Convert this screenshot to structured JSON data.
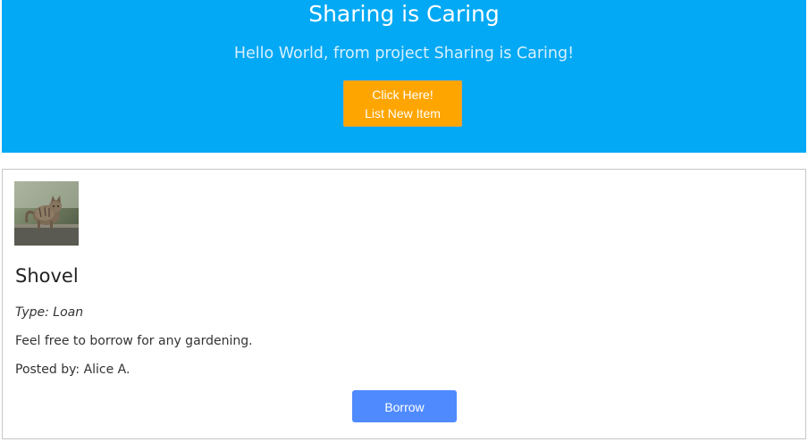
{
  "hero": {
    "title": "Sharing is Caring",
    "subtitle": "Hello World, from project Sharing is Caring!",
    "cta_line1": "Click Here!",
    "cta_line2": "List New Item"
  },
  "item": {
    "name": "Shovel",
    "type": "Type: Loan",
    "description": "Feel free to borrow for any gardening.",
    "posted_by": "Posted by: Alice A.",
    "borrow_label": "Borrow",
    "image_alt": "cat photo"
  },
  "colors": {
    "hero_bg": "#03a9f4",
    "cta_bg": "#ffa500",
    "borrow_bg": "#4f8bff"
  }
}
